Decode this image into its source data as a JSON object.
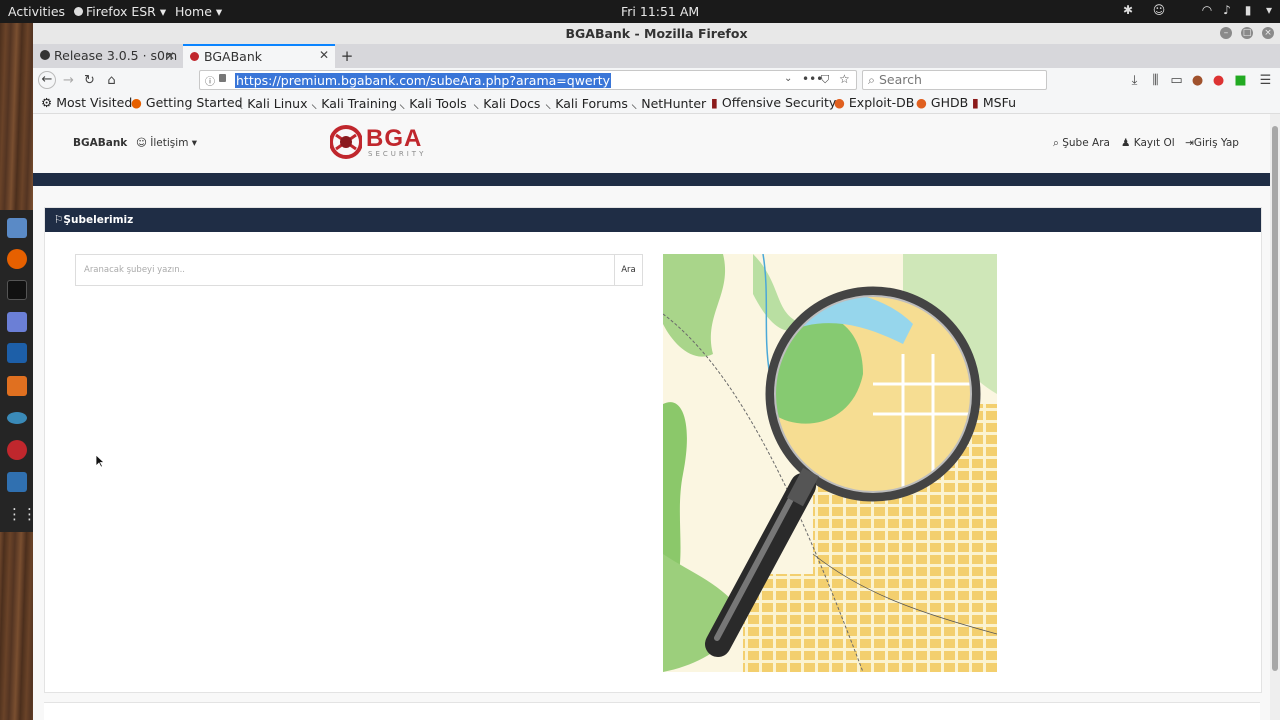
{
  "topbar": {
    "activities": "Activities",
    "app_menu": "Firefox ESR ▾",
    "places": "Home ▾",
    "clock": "Fri 11:51 AM"
  },
  "window": {
    "title": "BGABank - Mozilla Firefox"
  },
  "tabs": [
    {
      "label": "Release 3.0.5 · s0m"
    },
    {
      "label": "BGABank"
    }
  ],
  "navbar": {
    "url": "https://premium.bgabank.com/subeAra.php?arama=qwerty",
    "search_placeholder": "Search"
  },
  "bookmarks": [
    "Most Visited",
    "Getting Started",
    "Kali Linux",
    "Kali Training",
    "Kali Tools",
    "Kali Docs",
    "Kali Forums",
    "NetHunter",
    "Offensive Security",
    "Exploit-DB",
    "GHDB",
    "MSFu"
  ],
  "site": {
    "brand": "BGABank",
    "contact_menu": "İletişim",
    "logo_text": "BGA",
    "logo_subtext": "SECURITY",
    "branch_search": "Şube Ara",
    "register": "Kayıt Ol",
    "login": "Giriş Yap"
  },
  "panel": {
    "title": "Şubelerimiz",
    "search_placeholder": "Aranacak şubeyi yazın..",
    "search_button": "Ara"
  },
  "colors": {
    "navy": "#1f2d45",
    "logo_red": "#c0272d",
    "url_highlight": "#3a76d8"
  }
}
